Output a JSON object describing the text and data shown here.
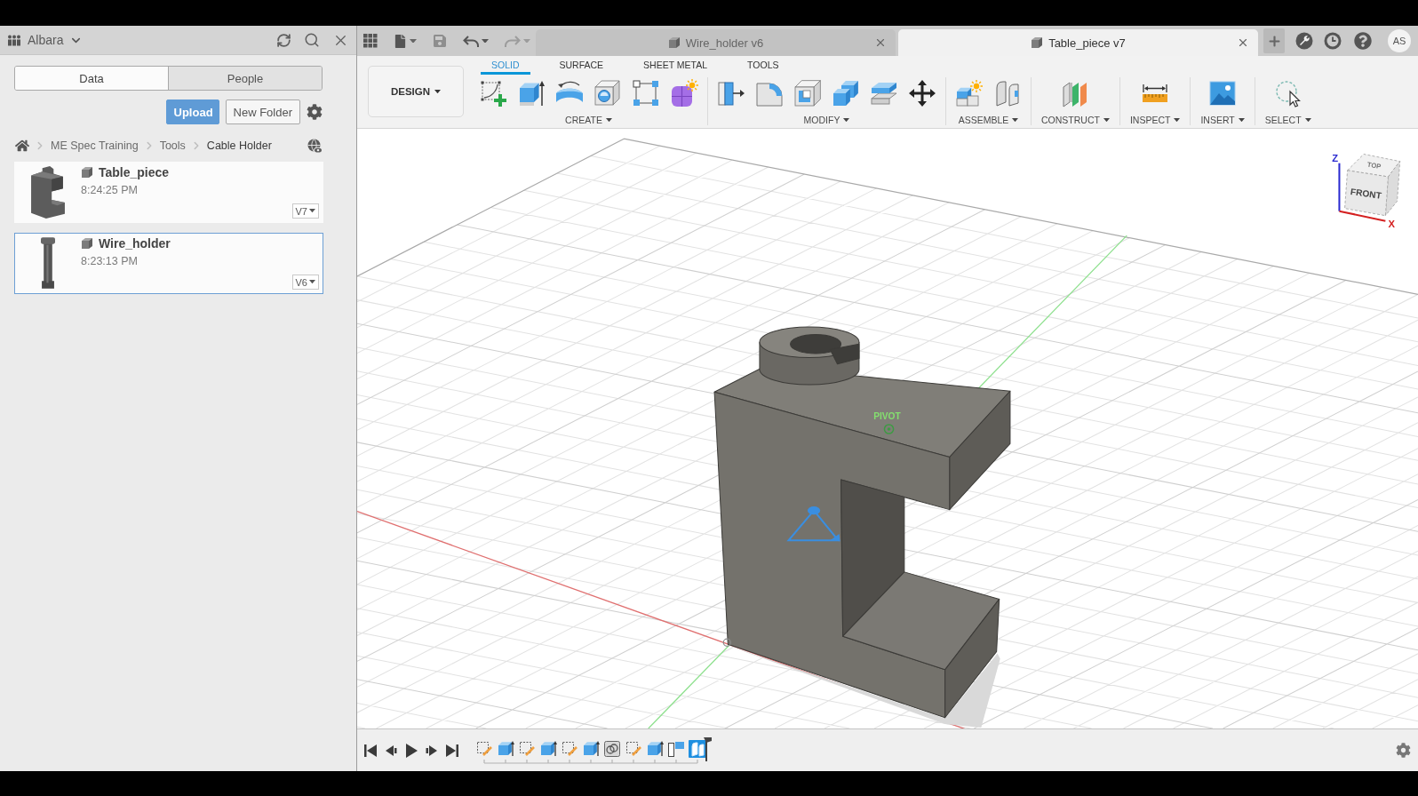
{
  "data_panel": {
    "team": "Albara",
    "tabs": [
      {
        "label": "Data",
        "selected": true
      },
      {
        "label": "People",
        "selected": false
      }
    ],
    "actions": [
      {
        "label": "Upload",
        "kind": "upload"
      },
      {
        "label": "New Folder",
        "kind": "new_folder"
      }
    ],
    "breadcrumb": [
      "ME Spec Training",
      "Tools",
      "Cable Holder"
    ],
    "files": [
      {
        "name": "Table_piece",
        "time": "8:24:25 PM",
        "version": "V7",
        "kind": "bracket",
        "selected": false
      },
      {
        "name": "Wire_holder",
        "time": "8:23:13 PM",
        "version": "V6",
        "kind": "rod",
        "selected": true
      }
    ]
  },
  "history": [
    {
      "kind": "undo",
      "disabled": false
    },
    {
      "kind": "redo",
      "disabled": true
    }
  ],
  "document_tabs": [
    {
      "title": "Wire_holder v6",
      "selected": false
    },
    {
      "title": "Table_piece v7",
      "selected": true
    }
  ],
  "user": {
    "initials": "AS"
  },
  "toolbar": {
    "workspace": "DESIGN",
    "tabs": [
      {
        "label": "SOLID",
        "selected": true
      },
      {
        "label": "SURFACE",
        "selected": false
      },
      {
        "label": "SHEET METAL",
        "selected": false
      },
      {
        "label": "TOOLS",
        "selected": false
      }
    ],
    "groups": [
      {
        "label": "CREATE",
        "tools": [
          {
            "kind": "sketch"
          },
          {
            "kind": "extrude"
          },
          {
            "kind": "revolve"
          },
          {
            "kind": "hole"
          },
          {
            "kind": "pattern"
          },
          {
            "kind": "form"
          }
        ]
      },
      {
        "label": "MODIFY",
        "tools": [
          {
            "kind": "press_pull"
          },
          {
            "kind": "fillet"
          },
          {
            "kind": "shell"
          },
          {
            "kind": "combine"
          },
          {
            "kind": "offset_face"
          },
          {
            "kind": "move"
          }
        ]
      },
      {
        "label": "ASSEMBLE",
        "tools": [
          {
            "kind": "new_component"
          },
          {
            "kind": "joint"
          }
        ]
      },
      {
        "label": "CONSTRUCT",
        "tools": [
          {
            "kind": "plane"
          }
        ]
      },
      {
        "label": "INSPECT",
        "tools": [
          {
            "kind": "measure"
          }
        ]
      },
      {
        "label": "INSERT",
        "tools": [
          {
            "kind": "image"
          }
        ]
      },
      {
        "label": "SELECT",
        "tools": [
          {
            "kind": "select"
          }
        ]
      }
    ]
  },
  "viewport": {
    "pivot_label": "PIVOT",
    "view_cube": {
      "faces": [
        {
          "label": "TOP",
          "kind": "top"
        },
        {
          "label": "FRONT",
          "kind": "front"
        }
      ],
      "axes": [
        {
          "label": "Z",
          "kind": "z"
        },
        {
          "label": "X",
          "kind": "x"
        }
      ]
    }
  },
  "timeline": {
    "features": [
      {
        "kind": "sketch",
        "selected": false
      },
      {
        "kind": "extrude",
        "selected": false
      },
      {
        "kind": "sketch",
        "selected": false
      },
      {
        "kind": "extrude",
        "selected": false
      },
      {
        "kind": "sketch",
        "selected": false
      },
      {
        "kind": "extrude",
        "selected": false
      },
      {
        "kind": "combine",
        "selected": false
      },
      {
        "kind": "sketch",
        "selected": false
      },
      {
        "kind": "extrude",
        "selected": false
      },
      {
        "kind": "plane",
        "selected": false
      },
      {
        "kind": "joint",
        "selected": true
      }
    ]
  }
}
